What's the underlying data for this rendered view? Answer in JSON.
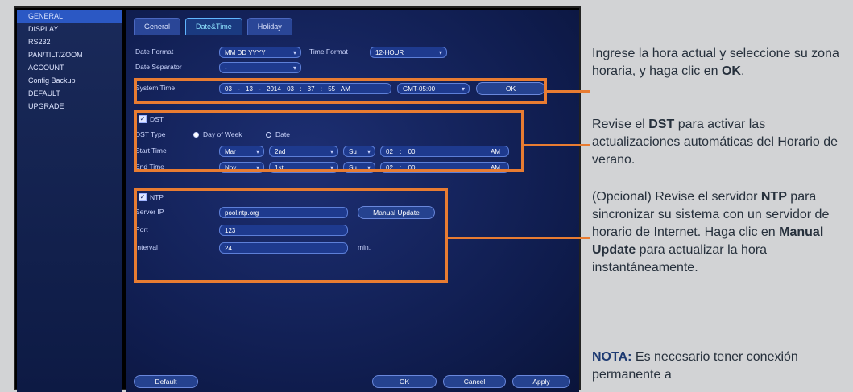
{
  "sidebar": {
    "items": [
      {
        "label": "GENERAL",
        "active": true
      },
      {
        "label": "DISPLAY"
      },
      {
        "label": "RS232"
      },
      {
        "label": "PAN/TILT/ZOOM"
      },
      {
        "label": "ACCOUNT"
      },
      {
        "label": "Config Backup"
      },
      {
        "label": "DEFAULT"
      },
      {
        "label": "UPGRADE"
      }
    ]
  },
  "tabs": [
    {
      "label": "General"
    },
    {
      "label": "Date&Time",
      "active": true
    },
    {
      "label": "Holiday"
    }
  ],
  "datetime": {
    "date_format_label": "Date Format",
    "date_format_value": "MM DD YYYY",
    "time_format_label": "Time Format",
    "time_format_value": "12-HOUR",
    "date_separator_label": "Date Separator",
    "date_separator_value": "-",
    "system_time_label": "System Time",
    "system_time": {
      "month": "03",
      "day": "13",
      "year": "2014",
      "hour": "03",
      "minute": "37",
      "second": "55",
      "ampm": "AM"
    },
    "timezone_value": "GMT-05:00",
    "ok_label": "OK"
  },
  "dst": {
    "label": "DST",
    "checked": true,
    "type_label": "DST Type",
    "option_day_of_week": "Day of Week",
    "option_date": "Date",
    "start_label": "Start Time",
    "start": {
      "month": "Mar",
      "week": "2nd",
      "day": "Su",
      "hour": "02",
      "minute": "00",
      "ampm": "AM"
    },
    "end_label": "End Time",
    "end": {
      "month": "Nov",
      "week": "1st",
      "day": "Su",
      "hour": "02",
      "minute": "00",
      "ampm": "AM"
    }
  },
  "ntp": {
    "label": "NTP",
    "checked": true,
    "server_label": "Server IP",
    "server_value": "pool.ntp.org",
    "manual_update_label": "Manual Update",
    "port_label": "Port",
    "port_value": "123",
    "interval_label": "Interval",
    "interval_value": "24",
    "interval_unit": "min."
  },
  "footer": {
    "default_label": "Default",
    "ok_label": "OK",
    "cancel_label": "Cancel",
    "apply_label": "Apply"
  },
  "notes": {
    "n1_a": "Ingrese la hora actual y seleccione su zona horaria, y haga clic en ",
    "n1_b": "OK",
    "n1_c": ".",
    "n2_a": "Revise el ",
    "n2_b": "DST",
    "n2_c": " para activar las actualizaciones automáticas del Horario de verano.",
    "n3_a": "(Opcional) Revise el servidor ",
    "n3_b": "NTP",
    "n3_c": " para sincronizar su sistema con un servidor de horario de Internet. Haga clic en ",
    "n3_d": "Manual Update",
    "n3_e": " para actualizar la hora instantáneamente.",
    "n4_a": "NOTA:",
    "n4_b": " Es necesario tener conexión permanente a"
  },
  "colors": {
    "accent": "#e87c32",
    "note_label": "#1d3a72"
  }
}
